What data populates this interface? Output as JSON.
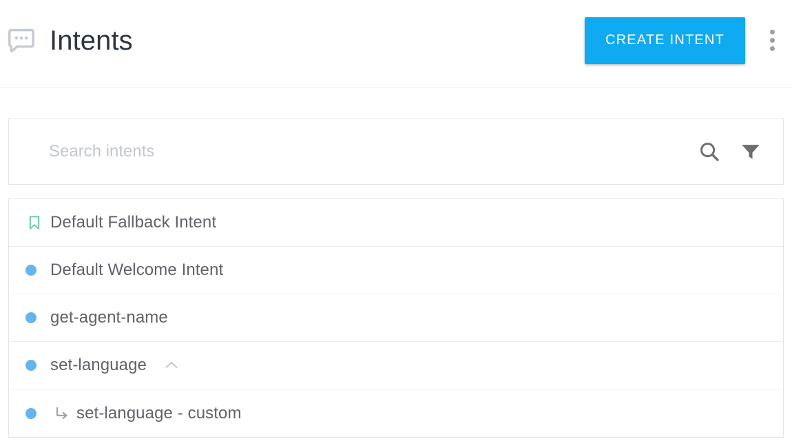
{
  "header": {
    "icon": "chat-bubble-dots-icon",
    "title": "Intents",
    "create_button_label": "CREATE INTENT",
    "overflow_menu": "more-vertical-icon"
  },
  "search": {
    "placeholder": "Search intents",
    "value": "",
    "search_icon": "search-icon",
    "filter_icon": "filter-icon"
  },
  "intents": [
    {
      "label": "Default Fallback Intent",
      "marker": "bookmark-icon",
      "marker_color": "#6bcfae",
      "child": false,
      "expandable": false
    },
    {
      "label": "Default Welcome Intent",
      "marker": "dot-icon",
      "marker_color": "#64b5ed",
      "child": false,
      "expandable": false
    },
    {
      "label": "get-agent-name",
      "marker": "dot-icon",
      "marker_color": "#64b5ed",
      "child": false,
      "expandable": false
    },
    {
      "label": "set-language",
      "marker": "dot-icon",
      "marker_color": "#64b5ed",
      "child": false,
      "expandable": true,
      "expand_icon": "chevron-up-icon"
    },
    {
      "label": "set-language - custom",
      "marker": "dot-icon",
      "marker_color": "#64b5ed",
      "child": true,
      "child_icon": "subdirectory-arrow-right-icon",
      "expandable": false
    }
  ],
  "colors": {
    "accent_blue": "#0faaf0",
    "dot_blue": "#64b5ed",
    "bookmark_green": "#6bcfae",
    "title_text": "#2c3440",
    "row_text": "#5f6368",
    "placeholder": "#c3c7cc",
    "border": "#e3e5e8",
    "icon_gray": "#6e6e6e",
    "app_icon_gray": "#c5cad4"
  }
}
